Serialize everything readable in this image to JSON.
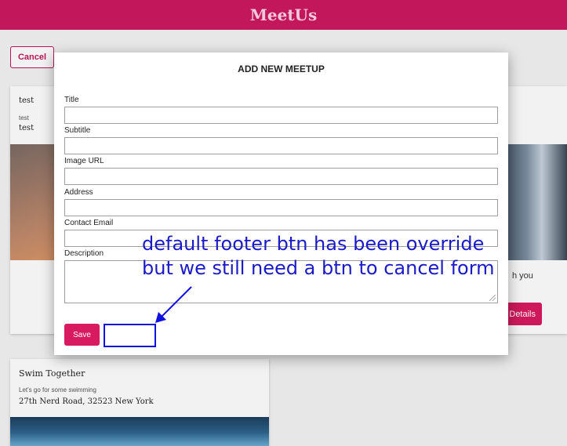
{
  "app": {
    "title": "MeetUs"
  },
  "page": {
    "cancel_label": "Cancel"
  },
  "cards": [
    {
      "title": "test",
      "subtitle": "test",
      "address": "test"
    },
    {
      "title": "Swim Together",
      "subtitle": "Let's go for some swimming",
      "address": "27th Nerd Road, 32523 New York"
    }
  ],
  "right_card": {
    "text_fragment": "h you",
    "details_label": "Details"
  },
  "modal": {
    "title": "ADD NEW MEETUP",
    "fields": [
      {
        "label": "Title",
        "value": ""
      },
      {
        "label": "Subtitle",
        "value": ""
      },
      {
        "label": "Image URL",
        "value": ""
      },
      {
        "label": "Address",
        "value": ""
      },
      {
        "label": "Contact Email",
        "value": ""
      },
      {
        "label": "Description",
        "value": ""
      }
    ],
    "save_label": "Save"
  },
  "annotation": {
    "line1": "default footer btn has been override",
    "line2": "but we still need a btn to cancel form",
    "color": "#1a1ac8"
  },
  "colors": {
    "brand": "#c2185b",
    "accent": "#d81b60"
  }
}
